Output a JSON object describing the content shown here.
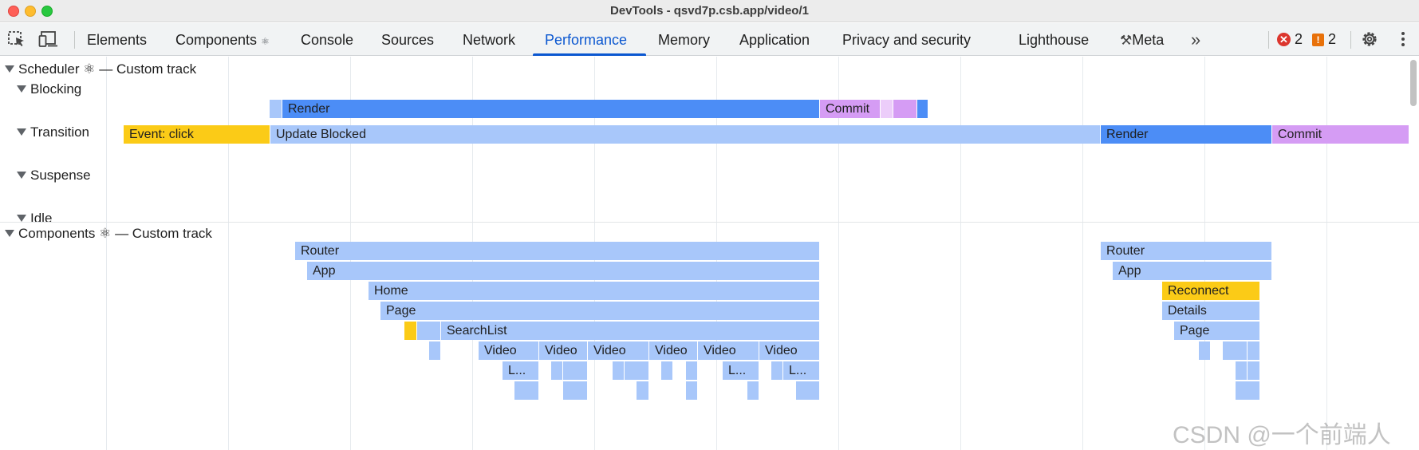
{
  "window": {
    "title": "DevTools - qsvd7p.csb.app/video/1"
  },
  "toolbar": {
    "tabs": [
      {
        "label": "Elements"
      },
      {
        "label": "Components",
        "suffix": "⚛"
      },
      {
        "label": "Console"
      },
      {
        "label": "Sources"
      },
      {
        "label": "Network"
      },
      {
        "label": "Performance",
        "active": true
      },
      {
        "label": "Memory"
      },
      {
        "label": "Application"
      },
      {
        "label": "Privacy and security"
      },
      {
        "label": "Lighthouse"
      },
      {
        "label": "Meta",
        "icon": "tools-icon"
      }
    ],
    "more_icon": "»",
    "error_count": "2",
    "warning_count": "2"
  },
  "scheduler": {
    "title": "Scheduler ⚛ — Custom track",
    "lanes": [
      "Blocking",
      "Transition",
      "Suspense",
      "Idle"
    ],
    "blocking_bars": [
      {
        "label": "",
        "color": "light"
      },
      {
        "label": "Render",
        "color": "dark"
      },
      {
        "label": "Commit",
        "color": "purple"
      },
      {
        "label": "",
        "color": "lightpurple"
      },
      {
        "label": "",
        "color": "purple"
      },
      {
        "label": "",
        "color": "dark"
      }
    ],
    "transition_bars": [
      {
        "label": "Event: click",
        "color": "yellow"
      },
      {
        "label": "Update Blocked",
        "color": "light"
      },
      {
        "label": "Render",
        "color": "dark"
      },
      {
        "label": "Commit",
        "color": "purple"
      }
    ]
  },
  "components": {
    "title": "Components ⚛ — Custom track",
    "left_tree": [
      "Router",
      "App",
      "Home",
      "Page",
      "SearchList",
      "Video",
      "Video",
      "Video",
      "Video",
      "Video",
      "Video",
      "L...",
      "L...",
      "L..."
    ],
    "right_tree": [
      "Router",
      "App",
      "Reconnect",
      "Details",
      "Page"
    ]
  },
  "watermark": "CSDN @一个前端人",
  "colors": {
    "light_blue": "#a8c7fa",
    "dark_blue": "#4c8df6",
    "yellow": "#fbcb17",
    "purple": "#d59cf4",
    "accent": "#0b57d0"
  }
}
